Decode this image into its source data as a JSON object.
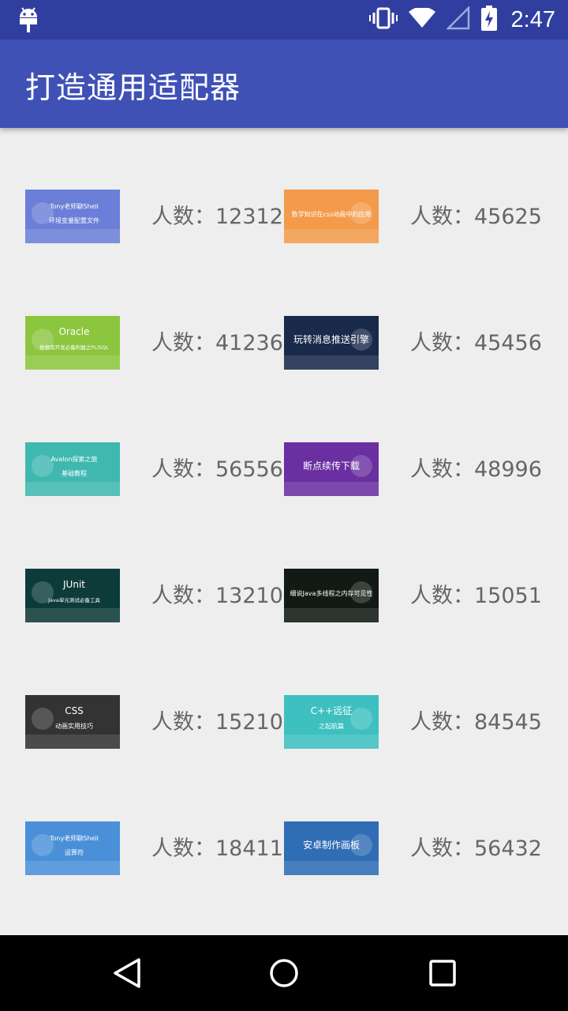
{
  "status_bar": {
    "time": "2:47",
    "icons": [
      "android-icon",
      "vibrate-icon",
      "wifi-icon",
      "signal-icon",
      "battery-charging-icon"
    ]
  },
  "app_bar": {
    "title": "打造通用适配器"
  },
  "items": [
    {
      "thumb_title": "Tony老师聊Shell",
      "thumb_sub": "环境变量配置文件",
      "count": "人数：12312",
      "bg": "#6b7fd8"
    },
    {
      "thumb_title": "数学知识在css动画中的应用",
      "thumb_sub": "",
      "count": "人数：45625",
      "bg": "#f39b4b"
    },
    {
      "thumb_title": "Oracle",
      "thumb_sub": "数据库开发必备利器之PL/SQL",
      "count": "人数：41236",
      "bg": "#8cc63f"
    },
    {
      "thumb_title": "玩转消息推送引擎",
      "thumb_sub": "",
      "count": "人数：45456",
      "bg": "#1a2a4a"
    },
    {
      "thumb_title": "Avalon探索之旅",
      "thumb_sub": "基础教程",
      "count": "人数：56556",
      "bg": "#3fb8b0"
    },
    {
      "thumb_title": "断点续传下载",
      "thumb_sub": "",
      "count": "人数：48996",
      "bg": "#6a2fa0"
    },
    {
      "thumb_title": "JUnit",
      "thumb_sub": "Java单元测试必备工具",
      "count": "人数：13210",
      "bg": "#0d3b3a"
    },
    {
      "thumb_title": "细说Java多线程之内存可见性",
      "thumb_sub": "",
      "count": "人数：15051",
      "bg": "#111a14"
    },
    {
      "thumb_title": "CSS",
      "thumb_sub": "动画实用技巧",
      "count": "人数：15210",
      "bg": "#333333"
    },
    {
      "thumb_title": "C++远征",
      "thumb_sub": "之起航篇",
      "count": "人数：84545",
      "bg": "#3ec0c0"
    },
    {
      "thumb_title": "Tony老师聊Shell",
      "thumb_sub": "运算符",
      "count": "人数：18411",
      "bg": "#4a90d9"
    },
    {
      "thumb_title": "安卓制作画板",
      "thumb_sub": "",
      "count": "人数：56432",
      "bg": "#2f6db5"
    }
  ]
}
